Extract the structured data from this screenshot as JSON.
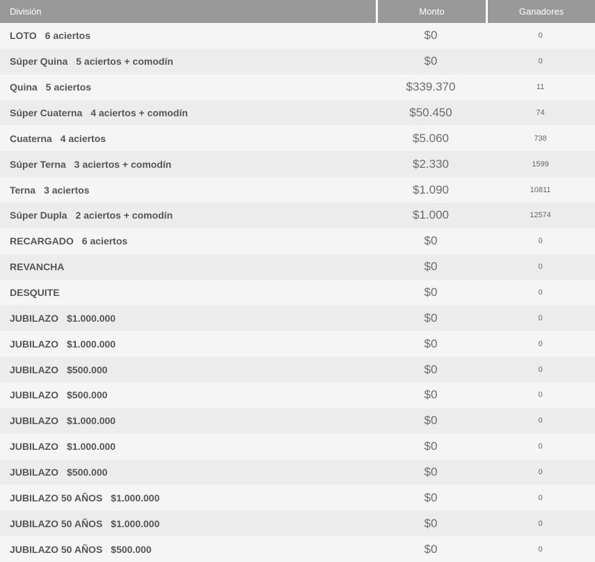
{
  "table": {
    "columns": [
      {
        "label": "División"
      },
      {
        "label": "Monto"
      },
      {
        "label": "Ganadores"
      }
    ],
    "rows": [
      {
        "division": "LOTO",
        "detail": "6 aciertos",
        "monto": "$0",
        "ganadores": "0"
      },
      {
        "division": "Súper Quina",
        "detail": "5 aciertos + comodín",
        "monto": "$0",
        "ganadores": "0"
      },
      {
        "division": "Quina",
        "detail": "5 aciertos",
        "monto": "$339.370",
        "ganadores": "11"
      },
      {
        "division": "Súper Cuaterna",
        "detail": "4 aciertos + comodín",
        "monto": "$50.450",
        "ganadores": "74"
      },
      {
        "division": "Cuaterna",
        "detail": "4 aciertos",
        "monto": "$5.060",
        "ganadores": "738"
      },
      {
        "division": "Súper Terna",
        "detail": "3 aciertos + comodín",
        "monto": "$2.330",
        "ganadores": "1599"
      },
      {
        "division": "Terna",
        "detail": "3 aciertos",
        "monto": "$1.090",
        "ganadores": "10811"
      },
      {
        "division": "Súper Dupla",
        "detail": "2 aciertos + comodín",
        "monto": "$1.000",
        "ganadores": "12574"
      },
      {
        "division": "RECARGADO",
        "detail": "6 aciertos",
        "monto": "$0",
        "ganadores": "0"
      },
      {
        "division": "REVANCHA",
        "detail": "",
        "monto": "$0",
        "ganadores": "0"
      },
      {
        "division": "DESQUITE",
        "detail": "",
        "monto": "$0",
        "ganadores": "0"
      },
      {
        "division": "JUBILAZO",
        "detail": "$1.000.000",
        "monto": "$0",
        "ganadores": "0"
      },
      {
        "division": "JUBILAZO",
        "detail": "$1.000.000",
        "monto": "$0",
        "ganadores": "0"
      },
      {
        "division": "JUBILAZO",
        "detail": "$500.000",
        "monto": "$0",
        "ganadores": "0"
      },
      {
        "division": "JUBILAZO",
        "detail": "$500.000",
        "monto": "$0",
        "ganadores": "0"
      },
      {
        "division": "JUBILAZO",
        "detail": "$1.000.000",
        "monto": "$0",
        "ganadores": "0"
      },
      {
        "division": "JUBILAZO",
        "detail": "$1.000.000",
        "monto": "$0",
        "ganadores": "0"
      },
      {
        "division": "JUBILAZO",
        "detail": "$500.000",
        "monto": "$0",
        "ganadores": "0"
      },
      {
        "division": "JUBILAZO 50 AÑOS",
        "detail": "$1.000.000",
        "monto": "$0",
        "ganadores": "0"
      },
      {
        "division": "JUBILAZO 50 AÑOS",
        "detail": "$1.000.000",
        "monto": "$0",
        "ganadores": "0"
      },
      {
        "division": "JUBILAZO 50 AÑOS",
        "detail": "$500.000",
        "monto": "$0",
        "ganadores": "0"
      }
    ]
  },
  "colors": {
    "header_bg": "#999999",
    "header_text": "#ffffff",
    "row_light": "#f5f5f5",
    "row_dark": "#ececec",
    "division_text": "#555555",
    "value_text": "#6b6b6b"
  }
}
